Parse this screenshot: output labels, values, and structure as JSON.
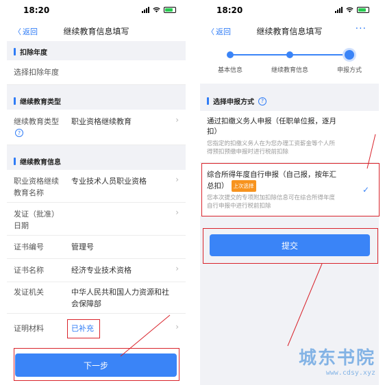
{
  "status": {
    "time": "18:20"
  },
  "left": {
    "back_label": "返回",
    "title": "继续教育信息填写",
    "sections": {
      "year_title": "扣除年度",
      "type_title": "继续教育类型",
      "info_title": "继续教育信息"
    },
    "year_row": {
      "label": "选择扣除年度"
    },
    "type_row": {
      "label": "继续教育类型",
      "value": "职业资格继续教育"
    },
    "rows": [
      {
        "label": "职业资格继续教育名称",
        "label_l1": "职业资格继续",
        "label_l2": "教育名称",
        "value": "专业技术人员职业资格"
      },
      {
        "label": "发证（批准）日期",
        "label_l1": "发证（批准）",
        "label_l2": "日期",
        "value": ""
      },
      {
        "label": "证书编号",
        "value": "管理号"
      },
      {
        "label": "证书名称",
        "value": "经济专业技术资格"
      },
      {
        "label": "发证机关",
        "value_l1": "中华人民共和国人力资源和社",
        "value_l2": "会保障部"
      },
      {
        "label": "证明材料",
        "value": "已补充"
      }
    ],
    "next_button": "下一步",
    "help_icon": "question-circle-icon"
  },
  "right": {
    "back_label": "返回",
    "title": "继续教育信息填写",
    "more": "···",
    "steps": [
      "基本信息",
      "继续教育信息",
      "申报方式"
    ],
    "section_title": "选择申报方式",
    "options": [
      {
        "title_l1": "通过扣缴义务人申报（任职单位报，逐月",
        "title_l2": "扣）",
        "desc_l1": "您指定的扣缴义务人在为您办理工资薪金等个人所",
        "desc_l2": "得预扣预缴申报时进行税前扣除",
        "selected": false
      },
      {
        "title_l1": "综合所得年度自行申报（自己报，按年汇",
        "title_l2": "总扣）",
        "tag": "上次选择",
        "desc_l1": "您本次提交的专项附加扣除信息可在综合所得年度",
        "desc_l2": "自行申报中进行税前扣除",
        "selected": true
      }
    ],
    "submit_button": "提交"
  },
  "watermark": {
    "main": "城东书院",
    "sub": "www.cdsy.xyz"
  },
  "colors": {
    "accent": "#3a84f7",
    "annotation": "#d9222a",
    "tag": "#f7931e"
  }
}
